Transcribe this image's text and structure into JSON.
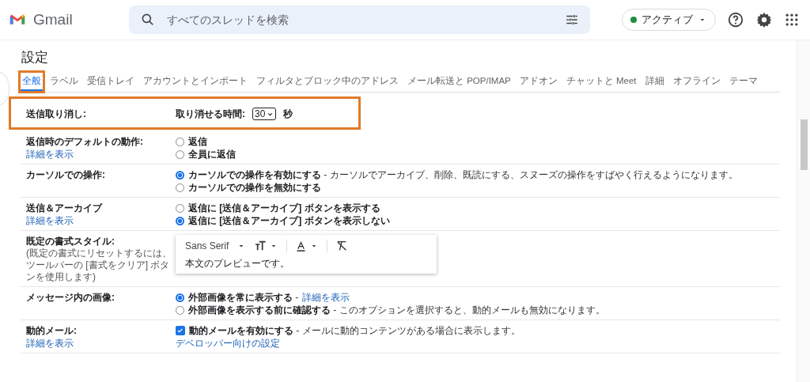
{
  "header": {
    "app_name": "Gmail",
    "search": {
      "placeholder": "すべてのスレッドを検索"
    },
    "status": {
      "label": "アクティブ",
      "color": "#1e8e3e"
    }
  },
  "settings": {
    "title": "設定",
    "tabs": [
      {
        "label": "全般",
        "selected": true,
        "highlighted": true
      },
      {
        "label": "ラベル",
        "selected": false,
        "highlighted": false
      },
      {
        "label": "受信トレイ",
        "selected": false,
        "highlighted": false
      },
      {
        "label": "アカウントとインポート",
        "selected": false,
        "highlighted": false
      },
      {
        "label": "フィルタとブロック中のアドレス",
        "selected": false,
        "highlighted": false
      },
      {
        "label": "メール転送と POP/IMAP",
        "selected": false,
        "highlighted": false
      },
      {
        "label": "アドオン",
        "selected": false,
        "highlighted": false
      },
      {
        "label": "チャットと Meet",
        "selected": false,
        "highlighted": false
      },
      {
        "label": "詳細",
        "selected": false,
        "highlighted": false
      },
      {
        "label": "オフライン",
        "selected": false,
        "highlighted": false
      },
      {
        "label": "テーマ",
        "selected": false,
        "highlighted": false
      }
    ],
    "rows": [
      {
        "kind": "select",
        "label": "送信取り消し:",
        "highlighted": true,
        "field_label": "取り消せる時間:",
        "value": "30",
        "unit": "秒"
      },
      {
        "kind": "options",
        "label": "返信時のデフォルトの動作:",
        "link": "詳細を表示",
        "highlighted": false,
        "options": [
          {
            "kind": "radio",
            "label": "返信",
            "selected": false
          },
          {
            "kind": "radio",
            "label": "全員に返信",
            "selected": false
          }
        ]
      },
      {
        "kind": "options",
        "label": "カーソルでの操作:",
        "highlighted": false,
        "options": [
          {
            "kind": "radio",
            "label": "カーソルでの操作を有効にする",
            "description": "- カーソルでアーカイブ、削除、既読にする、スヌーズの操作をすばやく行えるようになります。",
            "selected": true
          },
          {
            "kind": "radio",
            "label": "カーソルでの操作を無効にする",
            "selected": false
          }
        ]
      },
      {
        "kind": "options",
        "label": "送信＆アーカイブ",
        "link": "詳細を表示",
        "highlighted": false,
        "options": [
          {
            "kind": "radio",
            "label": "返信に [送信＆アーカイブ] ボタンを表示する",
            "selected": false
          },
          {
            "kind": "radio",
            "label": "返信に [送信＆アーカイブ] ボタンを表示しない",
            "selected": true
          }
        ]
      },
      {
        "kind": "editor",
        "label": "既定の書式スタイル:",
        "note": "(既定の書式にリセットするには、ツールバーの [書式をクリア] ボタンを使用します)",
        "highlighted": false,
        "font": "Sans Serif",
        "preview": "本文のプレビューです。"
      },
      {
        "kind": "options",
        "label": "メッセージ内の画像:",
        "highlighted": false,
        "options": [
          {
            "kind": "radio",
            "label": "外部画像を常に表示する",
            "description": "-",
            "option_link": "詳細を表示",
            "selected": true
          },
          {
            "kind": "radio",
            "label": "外部画像を表示する前に確認する",
            "description": "- このオプションを選択すると、動的メールも無効になります。",
            "selected": false
          }
        ]
      },
      {
        "kind": "options",
        "label": "動的メール:",
        "link": "詳細を表示",
        "highlighted": false,
        "options": [
          {
            "kind": "checkbox",
            "label": "動的メールを有効にする",
            "description": "- メールに動的コンテンツがある場合に表示します。",
            "selected": true
          }
        ],
        "footer_link": "デベロッパー向けの設定"
      }
    ]
  }
}
